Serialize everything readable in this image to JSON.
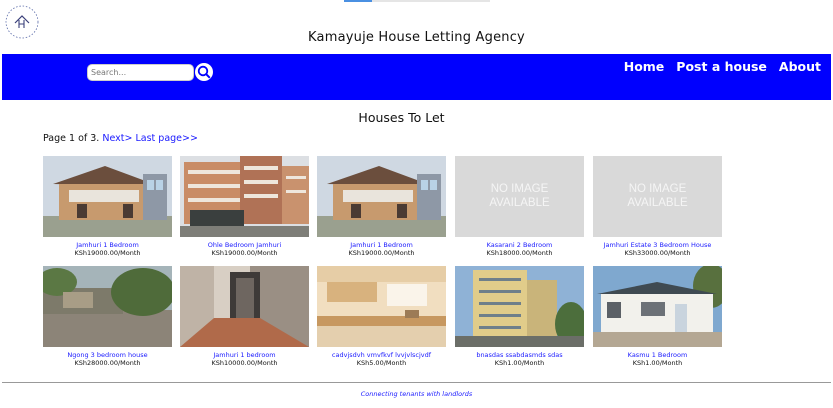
{
  "site": {
    "title": "Kamayuje House Letting Agency"
  },
  "search": {
    "placeholder": "Search..."
  },
  "nav": {
    "items": [
      "Home",
      "Post a house",
      "About"
    ]
  },
  "main": {
    "heading": "Houses To Let",
    "pager": {
      "text": "Page 1 of 3.",
      "next": "Next>",
      "last": "Last page>>"
    }
  },
  "listings": [
    {
      "title": "Jamhuri 1 Bedroom",
      "price": "KSh19000.00/Month",
      "image": "house-photo"
    },
    {
      "title": "Ohle Bedroom Jamhuri",
      "price": "KSh19000.00/Month",
      "image": "apartment-photo"
    },
    {
      "title": "Jamhuri 1 Bedroom",
      "price": "KSh19000.00/Month",
      "image": "house-photo"
    },
    {
      "title": "Kasarani 2 Bedroom",
      "price": "KSh18000.00/Month",
      "image": "no-image"
    },
    {
      "title": "Jamhuri Estate 3 Bedroom House",
      "price": "KSh33000.00/Month",
      "image": "no-image"
    },
    {
      "title": "Ngong 3 bedroom house",
      "price": "KSh28000.00/Month",
      "image": "yard-photo"
    },
    {
      "title": "Jamhuri 1 bedroom",
      "price": "KSh10000.00/Month",
      "image": "corridor-photo"
    },
    {
      "title": "cadvjsdvh vmvfkvf lvvjvlscjvdf",
      "price": "KSh5.00/Month",
      "image": "kitchen-photo"
    },
    {
      "title": "bnasdas ssabdasmds sdas",
      "price": "KSh1.00/Month",
      "image": "tower-photo"
    },
    {
      "title": "Kasmu 1 Bedroom",
      "price": "KSh1.00/Month",
      "image": "bungalow-photo"
    }
  ],
  "no_image": {
    "line1": "NO IMAGE",
    "line2": "AVAILABLE"
  },
  "footer": {
    "tagline": "Connecting tenants with landlords"
  },
  "colors": {
    "navbar": "#0000fe",
    "link": "#1a1aff"
  }
}
